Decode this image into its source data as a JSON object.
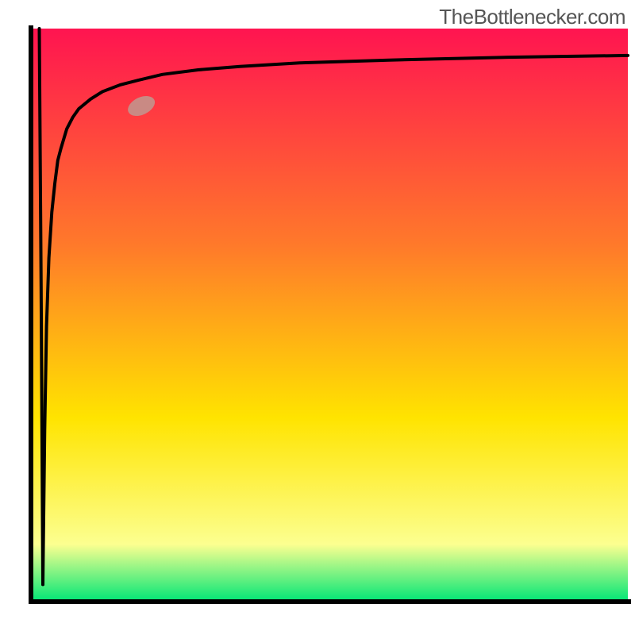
{
  "attribution": "TheBottlenecker.com",
  "colors": {
    "gradient_top": "#ff1450",
    "gradient_mid1": "#ff7a2a",
    "gradient_mid2": "#ffe400",
    "gradient_bottom_light": "#fcff90",
    "gradient_bottom": "#00e676",
    "axis": "#000000",
    "curve": "#000000",
    "marker_fill": "#c98a84",
    "marker_stroke": "#9a6860"
  },
  "chart_data": {
    "type": "line",
    "title": "",
    "xlabel": "",
    "ylabel": "",
    "xlim": [
      0,
      100
    ],
    "ylim": [
      0,
      100
    ],
    "grid": false,
    "legend": null,
    "series": [
      {
        "name": "bottleneck-curve",
        "x": [
          2.0,
          2.3,
          2.6,
          3.0,
          3.5,
          4.0,
          4.5,
          5.0,
          6.0,
          7.0,
          8.0,
          10,
          12,
          15,
          18,
          22,
          28,
          35,
          45,
          60,
          80,
          100
        ],
        "y": [
          3.0,
          30,
          48,
          60,
          68,
          73,
          77,
          79,
          82.5,
          84.5,
          86,
          87.7,
          89,
          90.2,
          91,
          92,
          92.8,
          93.4,
          94,
          94.5,
          95,
          95.3
        ]
      },
      {
        "name": "initial-drop",
        "x": [
          1.4,
          1.7,
          2.0
        ],
        "y": [
          100,
          55,
          3.0
        ]
      }
    ],
    "marker": {
      "x": 18.5,
      "y": 86.5,
      "length": 6.5,
      "angle_deg": 25
    },
    "annotations": []
  }
}
